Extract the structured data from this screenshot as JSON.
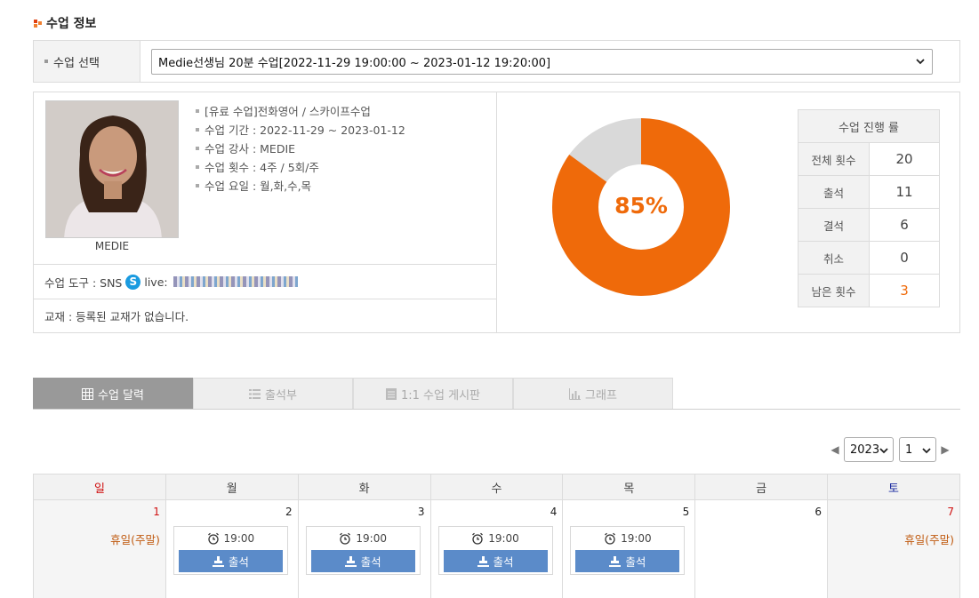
{
  "header": {
    "title": "수업 정보"
  },
  "class_select": {
    "label": "수업 선택",
    "value": "Medie선생님 20분 수업[2022-11-29 19:00:00 ~ 2023-01-12 19:20:00]"
  },
  "teacher": {
    "name": "MEDIE",
    "details": [
      "[유료 수업]전화영어 / 스카이프수업",
      "수업 기간 : 2022-11-29 ~ 2023-01-12",
      "수업 강사 : MEDIE",
      "수업 횟수 : 4주 / 5회/주",
      "수업 요일 : 월,화,수,목"
    ],
    "tool_label": "수업 도구 : SNS",
    "tool_account": "live:",
    "textbook": "교재 : 등록된 교재가 없습니다."
  },
  "progress": {
    "percent_text": "85%",
    "percent": 85,
    "title": "수업 진행 률",
    "rows": [
      {
        "label": "전체 횟수",
        "value": "20"
      },
      {
        "label": "출석",
        "value": "11"
      },
      {
        "label": "결석",
        "value": "6"
      },
      {
        "label": "취소",
        "value": "0"
      },
      {
        "label": "남은 횟수",
        "value": "3"
      }
    ],
    "colors": {
      "filled": "#ef6a0a",
      "remaining": "#d9d9d9"
    }
  },
  "tabs": [
    {
      "label": "수업 달력",
      "icon": "grid-icon",
      "active": true
    },
    {
      "label": "출석부",
      "icon": "list-icon",
      "active": false
    },
    {
      "label": "1:1 수업 게시판",
      "icon": "board-icon",
      "active": false
    },
    {
      "label": "그래프",
      "icon": "bar-chart-icon",
      "active": false
    }
  ],
  "calendar": {
    "year": "2023",
    "month": "1",
    "weekdays": [
      "일",
      "월",
      "화",
      "수",
      "목",
      "금",
      "토"
    ],
    "week1": [
      {
        "day": "1",
        "holiday": "휴일(주말)"
      },
      {
        "day": "2",
        "time": "19:00",
        "button": "출석"
      },
      {
        "day": "3",
        "time": "19:00",
        "button": "출석"
      },
      {
        "day": "4",
        "time": "19:00",
        "button": "출석"
      },
      {
        "day": "5",
        "time": "19:00",
        "button": "출석"
      },
      {
        "day": "6"
      },
      {
        "day": "7",
        "holiday": "휴일(주말)"
      }
    ]
  }
}
